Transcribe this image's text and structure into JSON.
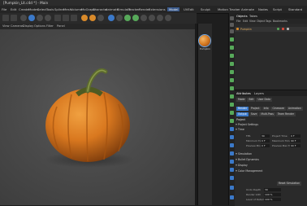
{
  "window": {
    "title": "[Pumpkin_Lit.c4d *] - Main"
  },
  "menu": {
    "items": [
      "File",
      "Edit",
      "Create",
      "Modes",
      "Select",
      "Tools",
      "Spline",
      "Mesh",
      "Volume",
      "MoGraph",
      "Character",
      "Animate",
      "Simulate",
      "Tracker",
      "Render",
      "Extensions",
      "Pipeline",
      "Window",
      "Help"
    ],
    "active": "Model"
  },
  "layouts": [
    "Model",
    "UVEdit",
    "Sculpt",
    "Motion Tracker",
    "Animate",
    "Nodes",
    "Script",
    "Standard",
    "Track",
    "Startup"
  ],
  "viewport_menu": [
    "View",
    "Cameras",
    "Display",
    "Options",
    "Filter",
    "Panel"
  ],
  "material": {
    "name": "Pumpkin"
  },
  "objects_panel": {
    "tabs": [
      "Objects",
      "Takes"
    ],
    "menu": [
      "File",
      "Edit",
      "View",
      "Object",
      "Tags",
      "Bookmarks"
    ],
    "object_name": "Pumpkin"
  },
  "attributes_panel": {
    "tabs": [
      "Attributes",
      "Layers"
    ],
    "mode_menu": [
      "Mode",
      "Edit",
      "User Data"
    ],
    "tabs_row1": [
      "Render",
      "Project",
      "Info",
      "Cineware",
      "Animation"
    ],
    "tabs_row2": [
      "Output",
      "Save",
      "Multi-Pass",
      "Team Render",
      "Material Override"
    ],
    "section": "Project",
    "subsections": [
      "Project Settings",
      "Time"
    ],
    "fields": [
      {
        "label": "FPS",
        "value": "30"
      },
      {
        "label": "Minimum Time",
        "value": "0 F"
      },
      {
        "label": "Preview Min Time",
        "value": "0 F"
      },
      {
        "label": "Project Time",
        "value": "0 F"
      },
      {
        "label": "Maximum Time",
        "value": "90 F"
      },
      {
        "label": "Preview Max Time",
        "value": "90 F"
      }
    ],
    "collapsed": [
      "Simulation",
      "Bullet Dynamics",
      "Display",
      "Color Management"
    ],
    "reset_button": "Reset Simulation",
    "bottom_fields": [
      {
        "label": "Undo Depth",
        "value": "30"
      },
      {
        "label": "Render LOD",
        "value": "100 %"
      },
      {
        "label": "Level of Detail",
        "value": "100 %"
      }
    ]
  },
  "colors": {
    "accent": "#3b79c9",
    "pumpkin": "#d98a2a",
    "stem": "#5d6b2e"
  }
}
